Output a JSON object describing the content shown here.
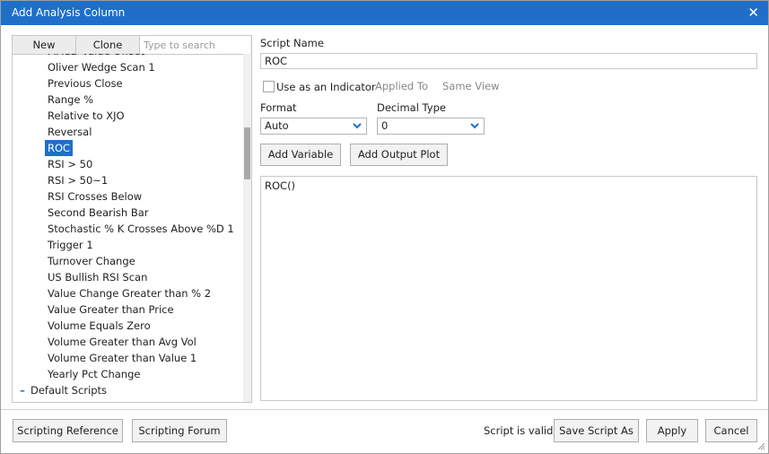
{
  "window": {
    "title": "Add Analysis Column",
    "close_glyph": "✕"
  },
  "left_panel": {
    "new_label": "New",
    "clone_label": "Clone",
    "search_placeholder": "Type to search",
    "items": [
      "MACD Value Offset",
      "Oliver Wedge Scan 1",
      "Previous Close",
      "Range %",
      "Relative to XJO",
      "Reversal",
      "ROC",
      "RSI > 50",
      "RSI > 50~1",
      "RSI Crosses Below",
      "Second Bearish Bar",
      "Stochastic % K Crosses Above %D 1",
      "Trigger 1",
      "Turnover Change",
      "US Bullish RSI Scan",
      "Value Change Greater than % 2",
      "Value Greater than Price",
      "Volume Equals Zero",
      "Volume Greater than Avg Vol",
      "Volume Greater than Value 1",
      "Yearly Pct Change"
    ],
    "selected_item": "ROC",
    "group_label": "Default Scripts"
  },
  "form": {
    "script_name_label": "Script Name",
    "script_name_value": "ROC",
    "use_as_indicator_label": "Use as an Indicator",
    "use_as_indicator_checked": false,
    "applied_to_label": "Applied To",
    "applied_to_value": "Same View",
    "format_label": "Format",
    "format_value": "Auto",
    "decimal_type_label": "Decimal Type",
    "decimal_type_value": "0",
    "add_variable_label": "Add Variable",
    "add_output_plot_label": "Add Output Plot",
    "script_text": "ROC()"
  },
  "footer": {
    "scripting_reference_label": "Scripting Reference",
    "scripting_forum_label": "Scripting Forum",
    "status_text": "Script is valid",
    "save_script_as_label": "Save Script As",
    "apply_label": "Apply",
    "cancel_label": "Cancel"
  },
  "colors": {
    "accent": "#1f6fc9",
    "chevron": "#1f6fc9"
  }
}
